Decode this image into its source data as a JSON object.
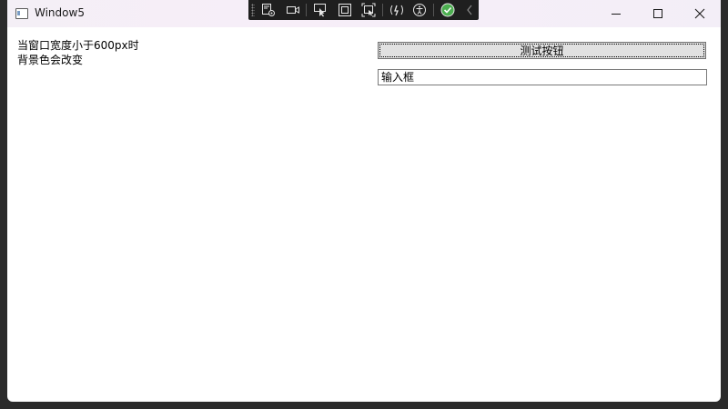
{
  "window": {
    "title": "Window5"
  },
  "content": {
    "hint_line1": "当窗口宽度小于600px时",
    "hint_line2": "背景色会改变",
    "button_label": "测试按钮",
    "input_value": "输入框"
  },
  "colors": {
    "titlebar": "#f5eff7",
    "background": "#ffffff",
    "button": "#e1e1e1",
    "toolbar": "#1f1f1f",
    "check_accent": "#4caf50"
  },
  "debug_toolbar": {
    "icons": [
      "element-select-icon",
      "video-icon",
      "pointer-select-icon",
      "frame-icon",
      "display-layout-icon",
      "hot-reload-icon",
      "accessibility-icon",
      "status-check-icon",
      "collapse-chevron-icon"
    ]
  }
}
